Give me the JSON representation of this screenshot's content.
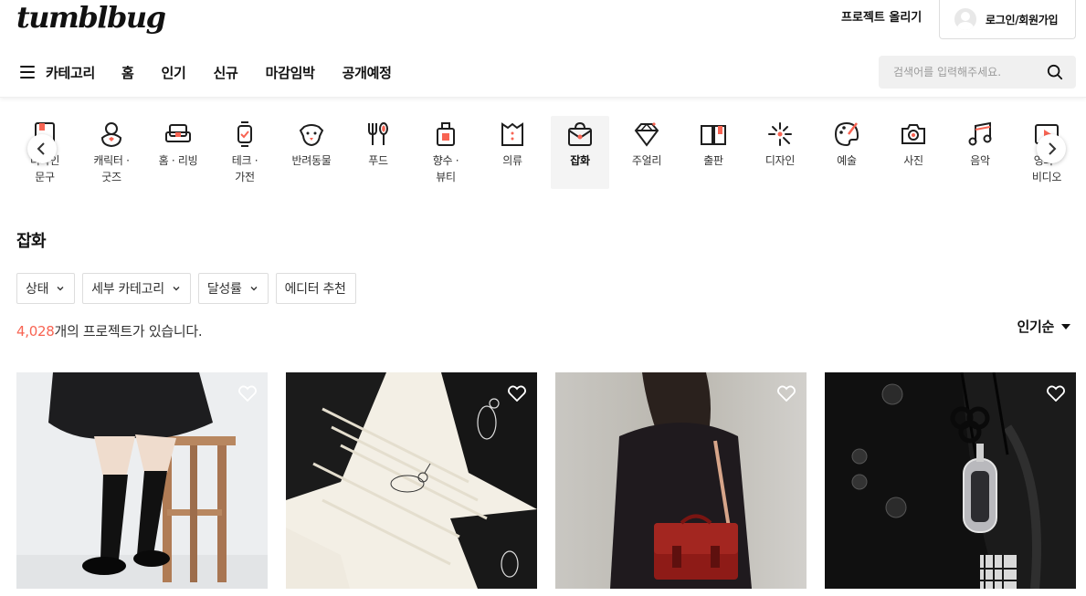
{
  "header": {
    "logo": "tumblbug",
    "upload_label": "프로젝트 올리기",
    "login_label": "로그인/회원가입"
  },
  "nav": {
    "category_label": "카테고리",
    "items": [
      "홈",
      "인기",
      "신규",
      "마감임박",
      "공개예정"
    ]
  },
  "search": {
    "placeholder": "검색어를 입력해주세요."
  },
  "categories": [
    {
      "l1": "디자인",
      "l2": "문구",
      "icon": "stationery-icon"
    },
    {
      "l1": "캐릭터 ·",
      "l2": "굿즈",
      "icon": "character-icon"
    },
    {
      "l1": "홈 · 리빙",
      "l2": "",
      "icon": "sofa-icon"
    },
    {
      "l1": "테크 ·",
      "l2": "가전",
      "icon": "watch-icon"
    },
    {
      "l1": "반려동물",
      "l2": "",
      "icon": "dog-icon"
    },
    {
      "l1": "푸드",
      "l2": "",
      "icon": "fork-spoon-icon"
    },
    {
      "l1": "향수 ·",
      "l2": "뷰티",
      "icon": "perfume-icon"
    },
    {
      "l1": "의류",
      "l2": "",
      "icon": "clothing-icon"
    },
    {
      "l1": "잡화",
      "l2": "",
      "icon": "bag-icon",
      "active": true
    },
    {
      "l1": "주얼리",
      "l2": "",
      "icon": "diamond-icon"
    },
    {
      "l1": "출판",
      "l2": "",
      "icon": "book-icon"
    },
    {
      "l1": "디자인",
      "l2": "",
      "icon": "sparkle-icon"
    },
    {
      "l1": "예술",
      "l2": "",
      "icon": "palette-icon"
    },
    {
      "l1": "사진",
      "l2": "",
      "icon": "camera-icon"
    },
    {
      "l1": "음악",
      "l2": "",
      "icon": "music-icon"
    },
    {
      "l1": "영화 ·",
      "l2": "비디오",
      "icon": "video-icon"
    }
  ],
  "page": {
    "title": "잡화",
    "count_number": "4,028",
    "count_suffix": "개의 프로젝트가 있습니다.",
    "sort_label": "인기순"
  },
  "filters": [
    "상태",
    "세부 카테고리",
    "달성률",
    "에디터 추천"
  ],
  "cards": [
    {
      "subject": "knee-socks-loafers-photo"
    },
    {
      "subject": "rabbit-embroidered-socks-photo"
    },
    {
      "subject": "red-satchel-bag-photo"
    },
    {
      "subject": "knot-ornament-pendant-photo"
    }
  ],
  "colors": {
    "accent": "#f86453",
    "text": "#1e1e1e"
  }
}
